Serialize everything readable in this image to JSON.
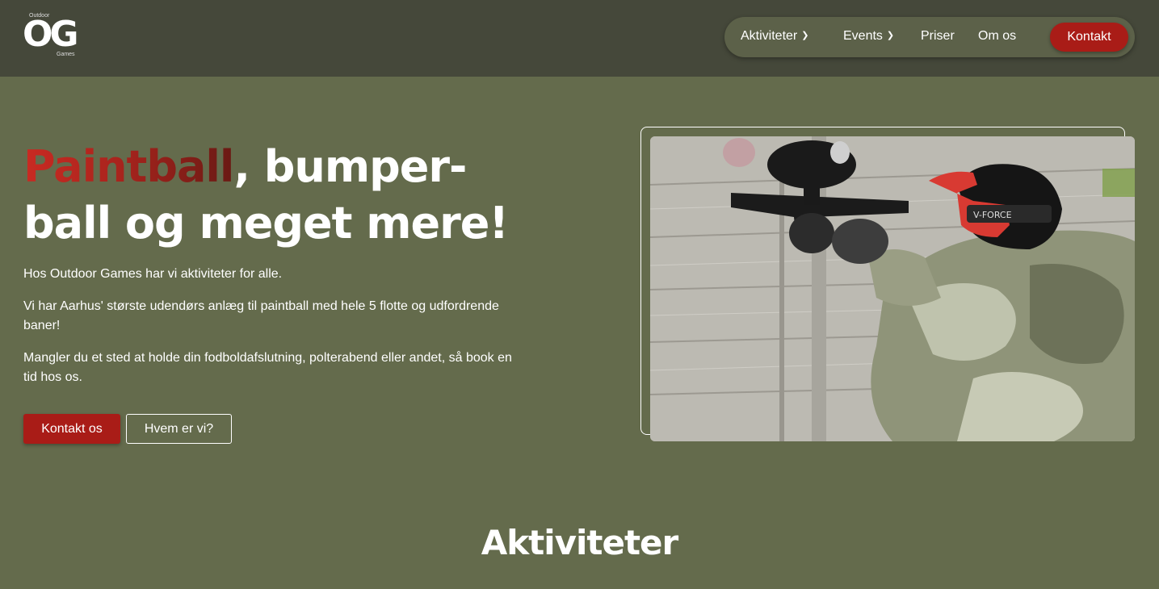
{
  "logo": {
    "letters": "OG",
    "top_word": "Outdoor",
    "bottom_word": "Games"
  },
  "nav": {
    "items": [
      {
        "label": "Aktiviteter",
        "has_dropdown": true
      },
      {
        "label": "Events",
        "has_dropdown": true
      },
      {
        "label": "Priser",
        "has_dropdown": false
      },
      {
        "label": "Om os",
        "has_dropdown": false
      }
    ],
    "cta_label": "Kontakt"
  },
  "hero": {
    "title_accent": "Paintball",
    "title_rest_line1": ", bumper-",
    "title_line2": "ball og meget mere!",
    "paragraphs": [
      "Hos Outdoor Games har vi aktiviteter for alle.",
      "Vi har Aarhus' største udendørs anlæg til paintball med hele 5 flotte og udfordrende baner!",
      "Mangler du et sted at holde din fodboldafslutning, polterabend eller andet, så book en tid hos os."
    ],
    "primary_button": "Kontakt os",
    "secondary_button": "Hvem er vi?",
    "image_mask_text": "V-FORCE"
  },
  "section": {
    "title": "Aktiviteter"
  },
  "colors": {
    "background": "#646b4c",
    "header": "#45483a",
    "accent_red": "#a91c17"
  }
}
